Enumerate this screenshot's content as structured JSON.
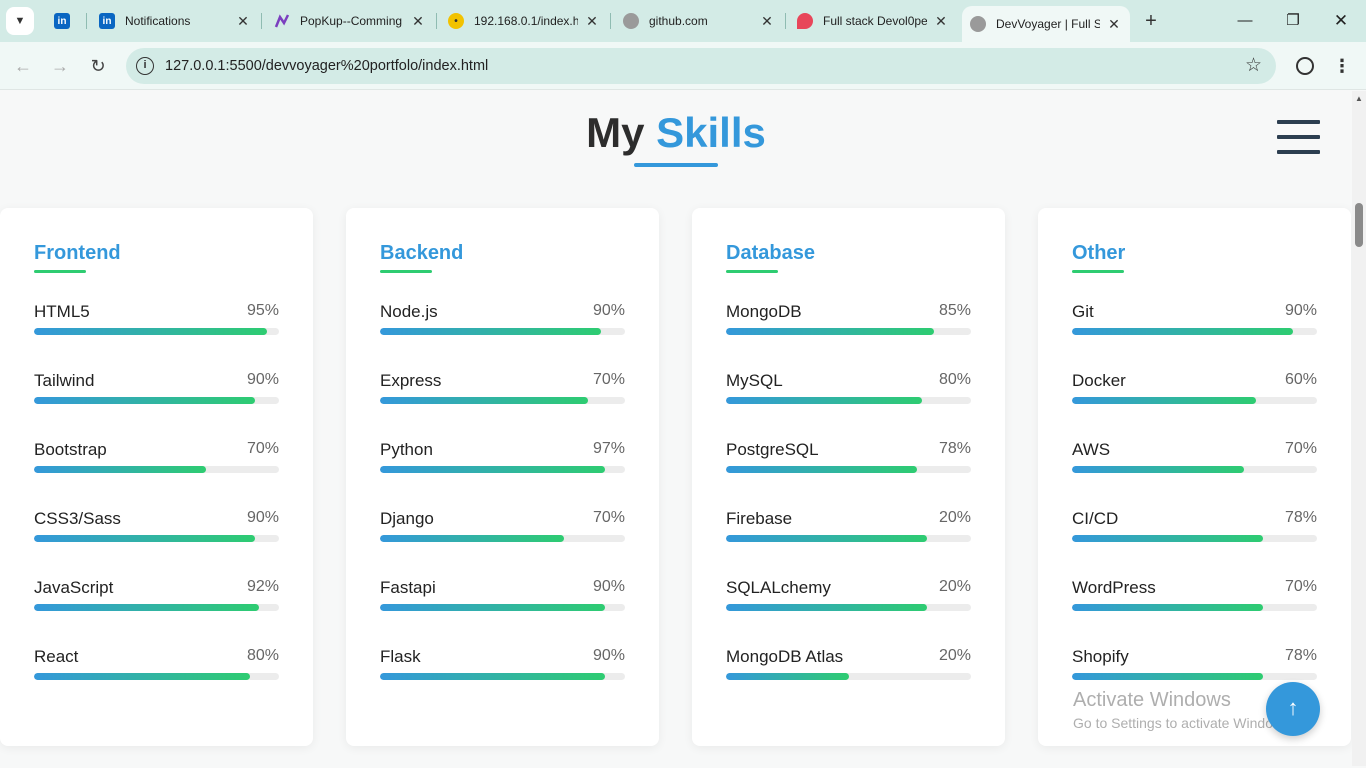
{
  "browser": {
    "tabs": [
      {
        "title": "",
        "icon": "linkedin-icon"
      },
      {
        "title": "Notifications",
        "icon": "linkedin-icon"
      },
      {
        "title": "PopKup--Comming",
        "icon": "popkup-icon"
      },
      {
        "title": "192.168.0.1/index.h",
        "icon": "router-icon"
      },
      {
        "title": "github.com",
        "icon": "globe-icon"
      },
      {
        "title": "Full stack Devol0pe",
        "icon": "devsite-icon"
      },
      {
        "title": "DevVoyager | Full St",
        "icon": "globe-icon"
      }
    ],
    "url": "127.0.0.1:5500/devvoyager%20portfolo/index.html"
  },
  "page": {
    "title_plain": "My",
    "title_accent": "Skills"
  },
  "skills": [
    {
      "category": "Frontend",
      "items": [
        {
          "name": "HTML5",
          "label": "95%",
          "level": 95
        },
        {
          "name": "Tailwind",
          "label": "90%",
          "level": 90
        },
        {
          "name": "Bootstrap",
          "label": "70%",
          "level": 70
        },
        {
          "name": "CSS3/Sass",
          "label": "90%",
          "level": 90
        },
        {
          "name": "JavaScript",
          "label": "92%",
          "level": 92
        },
        {
          "name": "React",
          "label": "80%",
          "level": 88
        }
      ]
    },
    {
      "category": "Backend",
      "items": [
        {
          "name": "Node.js",
          "label": "90%",
          "level": 90
        },
        {
          "name": "Express",
          "label": "70%",
          "level": 85
        },
        {
          "name": "Python",
          "label": "97%",
          "level": 92
        },
        {
          "name": "Django",
          "label": "70%",
          "level": 75
        },
        {
          "name": "Fastapi",
          "label": "90%",
          "level": 92
        },
        {
          "name": "Flask",
          "label": "90%",
          "level": 92
        }
      ]
    },
    {
      "category": "Database",
      "items": [
        {
          "name": "MongoDB",
          "label": "85%",
          "level": 85
        },
        {
          "name": "MySQL",
          "label": "80%",
          "level": 80
        },
        {
          "name": "PostgreSQL",
          "label": "78%",
          "level": 78
        },
        {
          "name": "Firebase",
          "label": "20%",
          "level": 82
        },
        {
          "name": "SQLALchemy",
          "label": "20%",
          "level": 82
        },
        {
          "name": "MongoDB Atlas",
          "label": "20%",
          "level": 50
        }
      ]
    },
    {
      "category": "Other",
      "items": [
        {
          "name": "Git",
          "label": "90%",
          "level": 90
        },
        {
          "name": "Docker",
          "label": "60%",
          "level": 75
        },
        {
          "name": "AWS",
          "label": "70%",
          "level": 70
        },
        {
          "name": "CI/CD",
          "label": "78%",
          "level": 78
        },
        {
          "name": "WordPress",
          "label": "70%",
          "level": 78
        },
        {
          "name": "Shopify",
          "label": "78%",
          "level": 78
        }
      ]
    }
  ],
  "overlay": {
    "watermark_title": "Activate Windows",
    "watermark_sub": "Go to Settings to activate Windows."
  },
  "colors": {
    "accent": "#3498db",
    "accent_green": "#2ecc71",
    "tabbar_bg": "#d3ebe6"
  }
}
